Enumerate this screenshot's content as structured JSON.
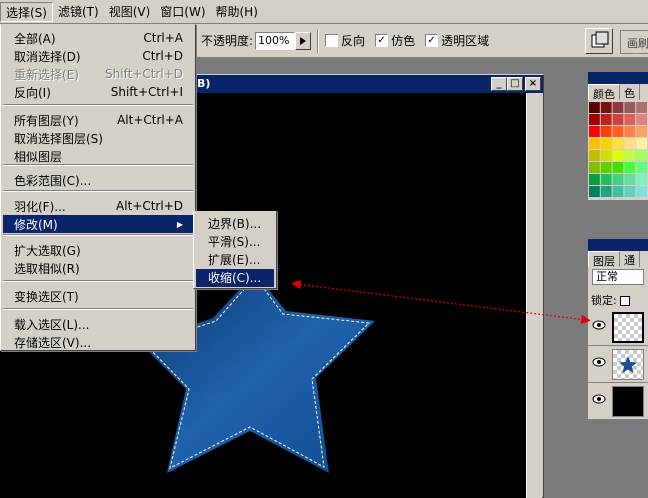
{
  "menubar": {
    "items": [
      {
        "label": "选择(S)",
        "active": true
      },
      {
        "label": "滤镜(T)"
      },
      {
        "label": "视图(V)"
      },
      {
        "label": "窗口(W)"
      },
      {
        "label": "帮助(H)"
      }
    ]
  },
  "options": {
    "opacity_label": "不透明度:",
    "opacity_value": "100%",
    "reverse_label": "反向",
    "dither_label": "仿色",
    "transparency_label": "透明区域",
    "well_label": "画刷"
  },
  "document": {
    "title": "B)"
  },
  "panels": {
    "swatches_tabs": [
      "颜色",
      "色"
    ],
    "layers_tabs": [
      "图层",
      "通"
    ],
    "blend_mode": "正常",
    "lock_label": "锁定:"
  },
  "select_menu": {
    "items": [
      {
        "label": "全部(A)",
        "shortcut": "Ctrl+A"
      },
      {
        "label": "取消选择(D)",
        "shortcut": "Ctrl+D"
      },
      {
        "label": "重新选择(E)",
        "shortcut": "Shift+Ctrl+D",
        "disabled": true
      },
      {
        "label": "反向(I)",
        "shortcut": "Shift+Ctrl+I"
      },
      {
        "label": "所有图层(Y)",
        "shortcut": "Alt+Ctrl+A"
      },
      {
        "label": "取消选择图层(S)",
        "shortcut": ""
      },
      {
        "label": "相似图层",
        "shortcut": ""
      },
      {
        "label": "色彩范围(C)...",
        "shortcut": ""
      },
      {
        "label": "羽化(F)...",
        "shortcut": "Alt+Ctrl+D"
      },
      {
        "label": "修改(M)",
        "shortcut": "",
        "submenu": true,
        "highlighted": true
      },
      {
        "label": "扩大选取(G)",
        "shortcut": ""
      },
      {
        "label": "选取相似(R)",
        "shortcut": ""
      },
      {
        "label": "变换选区(T)",
        "shortcut": ""
      },
      {
        "label": "载入选区(L)...",
        "shortcut": ""
      },
      {
        "label": "存储选区(V)...",
        "shortcut": ""
      }
    ]
  },
  "modify_submenu": {
    "items": [
      {
        "label": "边界(B)..."
      },
      {
        "label": "平滑(S)..."
      },
      {
        "label": "扩展(E)..."
      },
      {
        "label": "收缩(C)...",
        "highlighted": true
      }
    ]
  },
  "colors": {
    "menu_bg": "#d4d0c8",
    "highlight": "#0a246a",
    "canvas": "#000000",
    "star": "#1a5ca8",
    "annotation_arrow": "#e00000"
  }
}
